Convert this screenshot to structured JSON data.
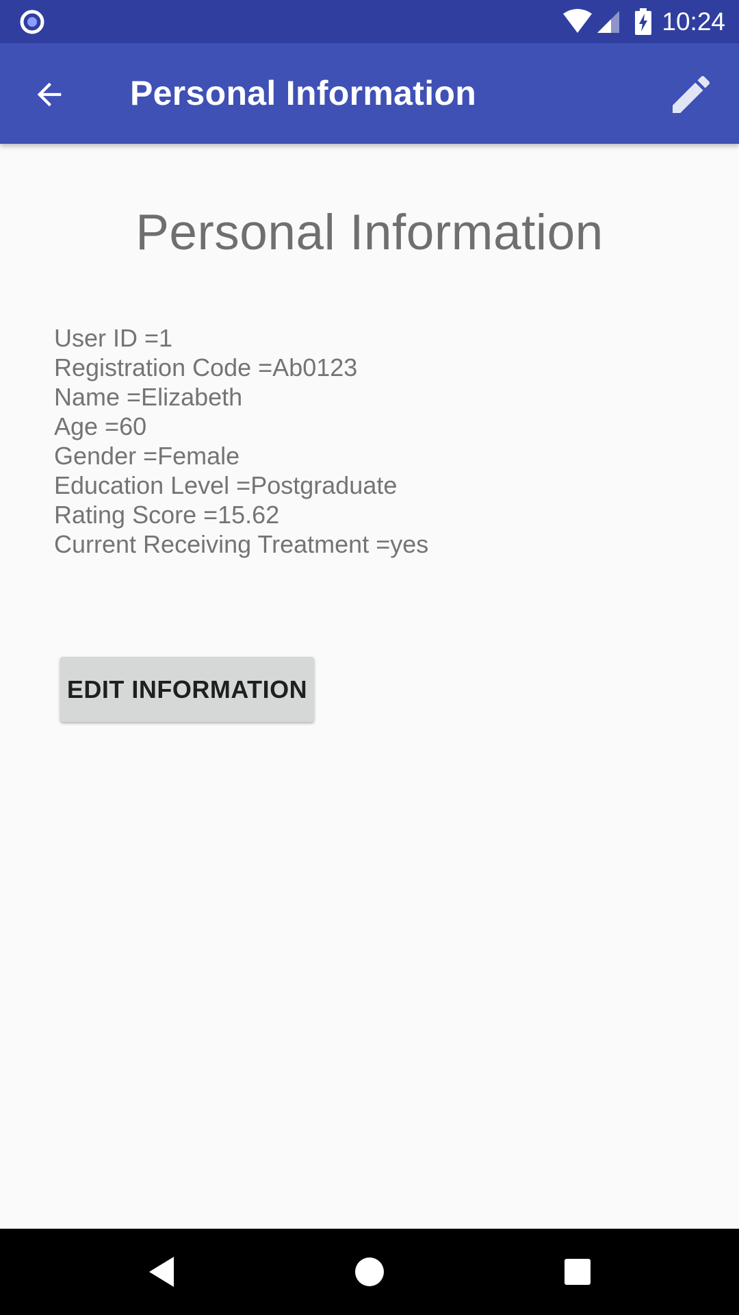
{
  "status_bar": {
    "time": "10:24",
    "icons": [
      "notification-circle-icon",
      "wifi-icon",
      "signal-icon",
      "battery-charging-icon"
    ]
  },
  "app_bar": {
    "title": "Personal Information",
    "icons": [
      "arrow-back-icon",
      "pencil-icon"
    ]
  },
  "main": {
    "heading": "Personal Information",
    "info_lines": [
      "User ID =1",
      "Registration Code =Ab0123",
      "Name =Elizabeth",
      "Age =60",
      "Gender =Female",
      "Education Level =Postgraduate",
      "Rating Score =15.62",
      "Current Receiving Treatment =yes"
    ],
    "edit_button_label": "EDIT INFORMATION"
  },
  "nav_bar": {
    "icons": [
      "triangle-back-icon",
      "circle-home-icon",
      "square-recents-icon"
    ]
  },
  "colors": {
    "status_bar": "#303f9f",
    "app_bar": "#3f51b5",
    "background": "#fafafa",
    "button": "#d6d7d7",
    "text": "#747474"
  }
}
